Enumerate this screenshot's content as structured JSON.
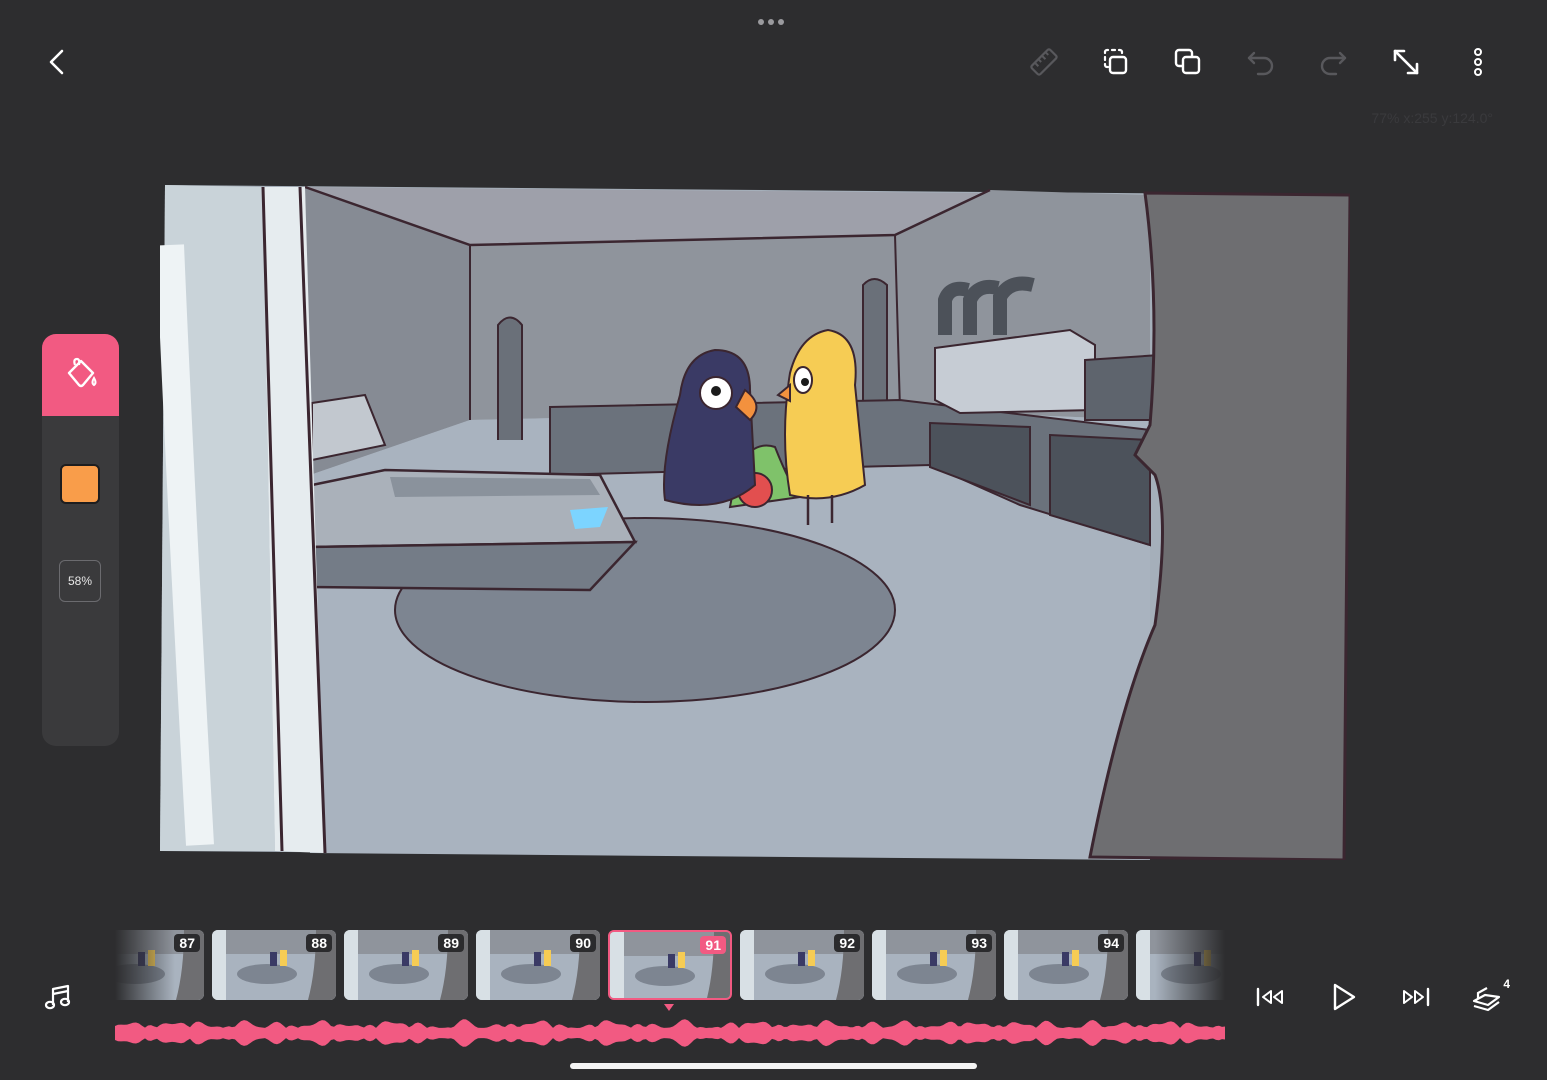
{
  "app": {
    "accent": "#f25a82",
    "background": "#2d2d2f"
  },
  "toolbar": {
    "back_icon": "chevron-left-icon",
    "items": [
      "ruler-icon",
      "duplicate-frame-icon",
      "copy-layer-icon",
      "undo-icon",
      "redo-icon",
      "expand-icon",
      "more-icon"
    ],
    "readout": "77% x:255 y:124.0°"
  },
  "tool_panel": {
    "active_tool_icon": "paint-bucket-icon",
    "color": "#f99d4a",
    "opacity": "58%"
  },
  "timeline": {
    "frames": [
      {
        "label": "87",
        "active": false
      },
      {
        "label": "88",
        "active": false
      },
      {
        "label": "89",
        "active": false
      },
      {
        "label": "90",
        "active": false
      },
      {
        "label": "91",
        "active": true
      },
      {
        "label": "92",
        "active": false
      },
      {
        "label": "93",
        "active": false
      },
      {
        "label": "94",
        "active": false
      },
      {
        "label": "",
        "active": false
      }
    ],
    "audio_icon": "music-note-icon",
    "controls": [
      "skip-back-icon",
      "play-icon",
      "skip-forward-icon",
      "layers-icon"
    ],
    "layers_badge": "4"
  }
}
